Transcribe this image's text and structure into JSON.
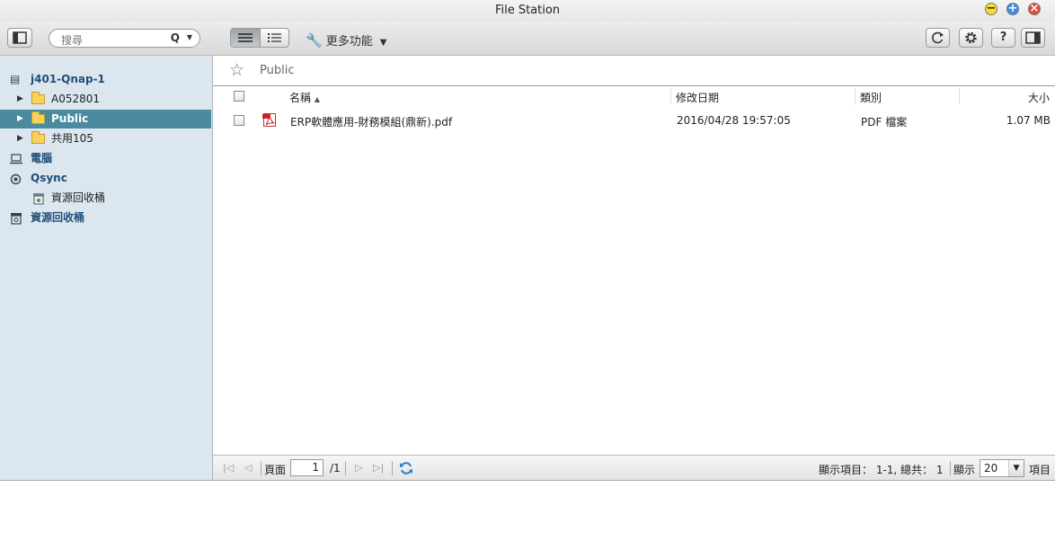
{
  "window": {
    "title": "File Station"
  },
  "toolbar": {
    "search_placeholder": "搜尋",
    "more_label": "更多功能"
  },
  "sidebar": {
    "items": [
      {
        "label": "j401-Qnap-1"
      },
      {
        "label": "A052801"
      },
      {
        "label": "Public"
      },
      {
        "label": "共用105"
      },
      {
        "label": "電腦"
      },
      {
        "label": "Qsync"
      },
      {
        "label": "資源回收桶"
      },
      {
        "label": "資源回收桶"
      }
    ]
  },
  "main": {
    "path": "Public",
    "columns": {
      "name": "名稱",
      "modified": "修改日期",
      "type": "類別",
      "size": "大小"
    },
    "sort_indicator": "▲",
    "files": [
      {
        "name": "ERP軟體應用-財務模組(鼎新).pdf",
        "modified": "2016/04/28 19:57:05",
        "type": "PDF 檔案",
        "size": "1.07 MB"
      }
    ]
  },
  "footer": {
    "page_label": "頁面",
    "page_value": "1",
    "page_total": "/1",
    "items_info": "顯示項目： 1-1, 總共： 1",
    "show_label": "顯示",
    "per_page": "20",
    "items_label": "項目"
  }
}
